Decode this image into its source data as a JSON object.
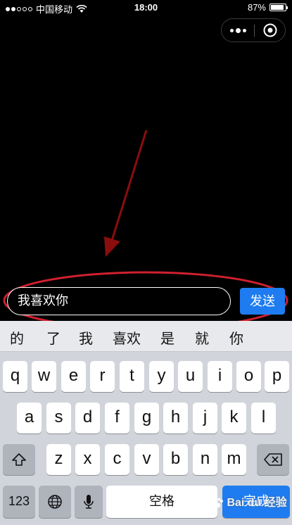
{
  "status_bar": {
    "carrier": "中国移动",
    "time": "18:00",
    "battery": "87%",
    "battery_level": 0.87,
    "signal_bars_filled": 2,
    "signal_bars_total": 5
  },
  "capsule": {
    "menu_icon": "more-dots-icon",
    "close_icon": "target-circle-icon"
  },
  "input": {
    "value": "我喜欢你"
  },
  "send_button": {
    "label": "发送"
  },
  "keyboard": {
    "candidates": [
      "的",
      "了",
      "我",
      "喜欢",
      "是",
      "就",
      "你"
    ],
    "row1": [
      "q",
      "w",
      "e",
      "r",
      "t",
      "y",
      "u",
      "i",
      "o",
      "p"
    ],
    "row2": [
      "a",
      "s",
      "d",
      "f",
      "g",
      "h",
      "j",
      "k",
      "l"
    ],
    "row3": [
      "z",
      "x",
      "c",
      "v",
      "b",
      "n",
      "m"
    ],
    "numbers_label": "123",
    "space_label": "空格",
    "return_label": "完成"
  },
  "watermark": {
    "text": "Bai du 经验"
  },
  "colors": {
    "accent": "#1e7cf0",
    "annotation_red": "#c8102e",
    "keyboard_bg": "#d1d4da",
    "candidate_bar": "#e8e9ec"
  }
}
